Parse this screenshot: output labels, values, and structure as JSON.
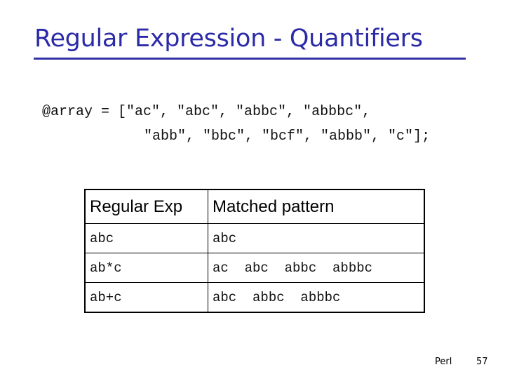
{
  "slide": {
    "title": "Regular Expression - Quantifiers",
    "code_lines": [
      "@array = [\"ac\", \"abc\", \"abbc\", \"abbbc\",",
      "\"abb\", \"bbc\", \"bcf\", \"abbb\", \"c\"];"
    ],
    "table": {
      "headers": [
        "Regular Exp",
        "Matched pattern"
      ],
      "rows": [
        {
          "regex": "abc",
          "matches": "abc"
        },
        {
          "regex": "ab*c",
          "matches": "ac  abc  abbc  abbbc"
        },
        {
          "regex": "ab+c",
          "matches": "abc  abbc  abbbc"
        }
      ]
    },
    "footer": {
      "label": "Perl",
      "page_number": "57"
    },
    "colors": {
      "title": "#2b2ba8",
      "text": "#111111",
      "border": "#000000"
    }
  }
}
